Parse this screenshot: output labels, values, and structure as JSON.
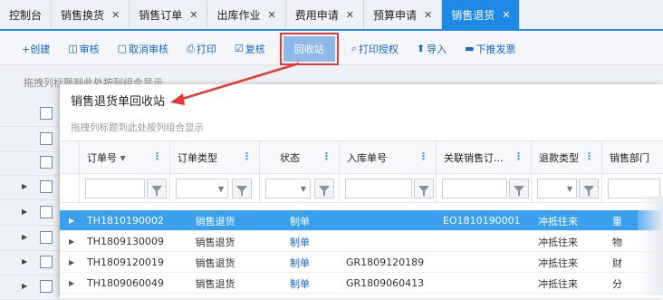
{
  "tabs": [
    {
      "label": "控制台",
      "closable": false,
      "active": false
    },
    {
      "label": "销售换货",
      "closable": true,
      "active": false
    },
    {
      "label": "销售订单",
      "closable": true,
      "active": false
    },
    {
      "label": "出库作业",
      "closable": true,
      "active": false
    },
    {
      "label": "费用申请",
      "closable": true,
      "active": false
    },
    {
      "label": "预算申请",
      "closable": true,
      "active": false
    },
    {
      "label": "销售退货",
      "closable": true,
      "active": true
    }
  ],
  "toolbar": {
    "create": "+创建",
    "audit": "审核",
    "cancel_audit": "取消审核",
    "print": "打印",
    "recheck": "复核",
    "recycle": "回收站",
    "print_auth": "打印授权",
    "import": "导入",
    "push_down": "下推发票"
  },
  "background": {
    "group_hint": "拖拽列标题到此处按列组合显示"
  },
  "modal": {
    "title": "销售退货单回收站",
    "group_hint": "拖拽列标题到此处按列组合显示",
    "columns": [
      "订单号",
      "订单类型",
      "状态",
      "入库单号",
      "关联销售订...",
      "退款类型",
      "销售部门"
    ],
    "sort_indicator": "▼",
    "rows": [
      {
        "order_no": "TH1810190002",
        "order_type": "销售退货",
        "status": "制单",
        "inbound_no": "",
        "related_order": "EO1810190001",
        "refund_type": "冲抵往来",
        "dept": "重",
        "selected": true
      },
      {
        "order_no": "TH1809130009",
        "order_type": "销售退货",
        "status": "制单",
        "inbound_no": "",
        "related_order": "",
        "refund_type": "冲抵往来",
        "dept": "物",
        "selected": false
      },
      {
        "order_no": "TH1809120019",
        "order_type": "销售退货",
        "status": "制单",
        "inbound_no": "GR1809120189",
        "related_order": "",
        "refund_type": "冲抵往来",
        "dept": "财",
        "selected": false
      },
      {
        "order_no": "TH1809060049",
        "order_type": "销售退货",
        "status": "制单",
        "inbound_no": "GR1809060413",
        "related_order": "",
        "refund_type": "冲抵往来",
        "dept": "分",
        "selected": false
      }
    ]
  },
  "colors": {
    "accent": "#1e88e5",
    "selected_row": "#3aa0ee",
    "highlight_border": "#e53935"
  }
}
